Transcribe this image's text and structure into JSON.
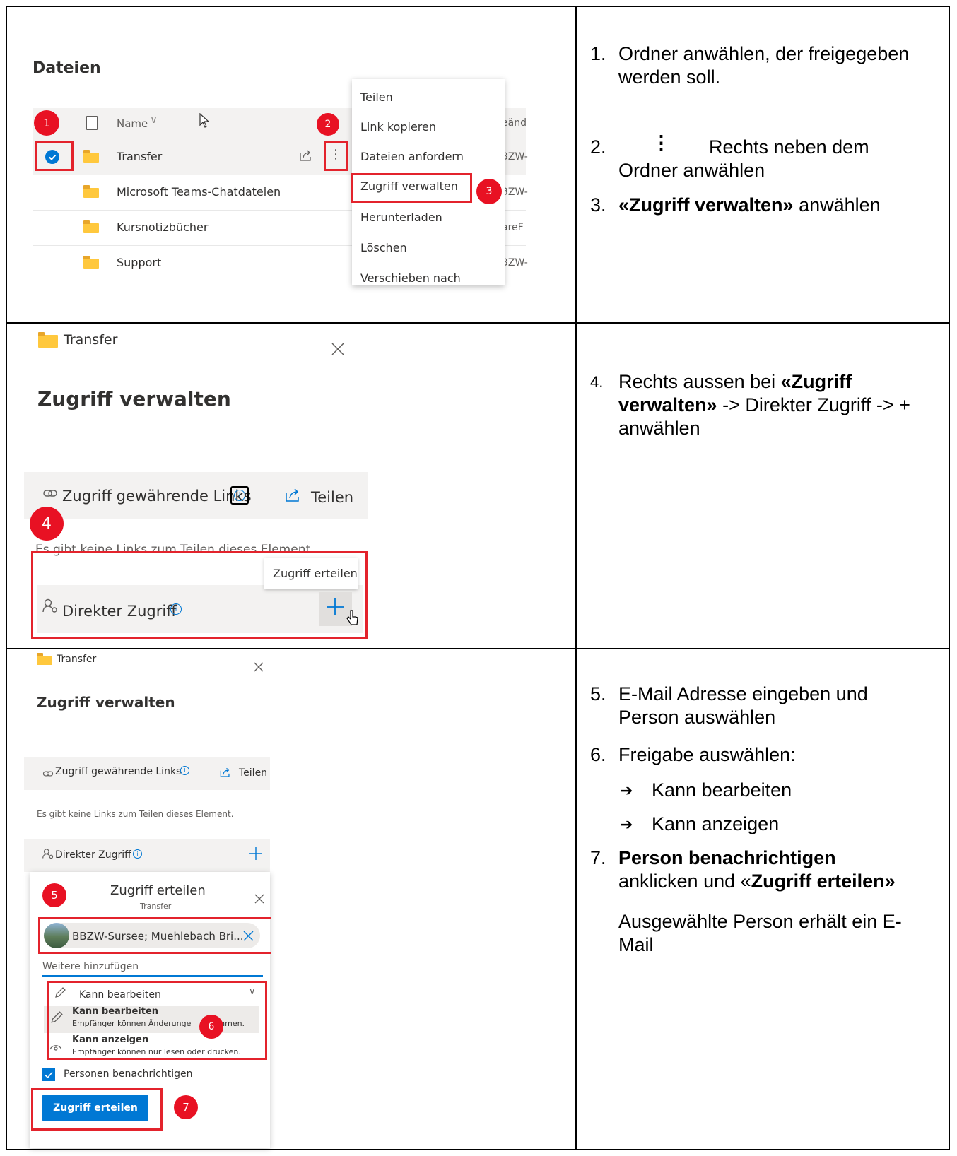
{
  "sec1": {
    "files_title": "Dateien",
    "name_header": "Name",
    "trunc_col_header": "eänd",
    "files": [
      {
        "name": "Transfer",
        "trunc": "3ZW-"
      },
      {
        "name": "Microsoft Teams-Chatdateien",
        "trunc": "3ZW-"
      },
      {
        "name": "Kursnotizbücher",
        "trunc": "areF"
      },
      {
        "name": "Support",
        "trunc": "3ZW-"
      }
    ],
    "menu": [
      "Teilen",
      "Link kopieren",
      "Dateien anfordern",
      "Zugriff verwalten",
      "Herunterladen",
      "Löschen",
      "Verschieben nach"
    ],
    "badges": [
      "1",
      "2",
      "3"
    ],
    "instructions": {
      "s1_num": "1.",
      "s1_text": "Ordner anwählen, der freigegeben werden soll.",
      "s2_num": "2.",
      "s2_icon": "⋮",
      "s2_text": "Rechts neben dem Ordner anwählen",
      "s3_num": "3.",
      "s3_bold": "«Zugriff verwalten»",
      "s3_rest": " anwählen"
    }
  },
  "sec2": {
    "breadcrumb": "Transfer",
    "title": "Zugriff verwalten",
    "links_label": "Zugriff gewährende Links",
    "share_label": "Teilen",
    "badge": "4",
    "no_links": "Es gibt keine Links zum Teilen dieses Element.",
    "tooltip": "Zugriff erteilen",
    "direct_label": "Direkter Zugriff",
    "instructions": {
      "num": "4.",
      "t1": "Rechts aussen bei ",
      "b1": "«Zugriff verwalten»",
      "t2": " -> Direkter Zugriff -> + anwählen"
    }
  },
  "sec3": {
    "breadcrumb": "Transfer",
    "title": "Zugriff verwalten",
    "links_label": "Zugriff gewährende Links",
    "share_label": "Teilen",
    "no_links": "Es gibt keine Links zum Teilen dieses Element.",
    "direct_label": "Direkter Zugriff",
    "dialog_title": "Zugriff erteilen",
    "dialog_subtitle": "Transfer",
    "person_chip": "BBZW-Sursee; Muehlebach Bri...",
    "add_more_placeholder": "Weitere hinzufügen",
    "permission_selected": "Kann bearbeiten",
    "options": [
      {
        "title": "Kann bearbeiten",
        "desc_a": "Empfänger können Änderunge",
        "desc_b": "ehmen."
      },
      {
        "title": "Kann anzeigen",
        "desc_a": "Empfänger können nur lesen oder drucken.",
        "desc_b": ""
      }
    ],
    "notify_label": "Personen benachrichtigen",
    "grant_button": "Zugriff erteilen",
    "badges": [
      "5",
      "6",
      "7"
    ],
    "instructions": {
      "s5_num": "5.",
      "s5_text": "E-Mail Adresse eingeben und Person auswählen",
      "s6_num": "6.",
      "s6_text": "Freigabe auswählen:",
      "arrow": "➔",
      "opt1": "Kann bearbeiten",
      "opt2": "Kann anzeigen",
      "s7_num": "7.",
      "s7_bold": "Person benachrichtigen",
      "s7_mid": " anklicken und «",
      "s7_bold2": "Zugriff erteilen»",
      "s7_note": "Ausgewählte Person erhält ein E-Mail"
    }
  },
  "colors": {
    "accent": "#0078d4",
    "badge": "#e81123",
    "highlight": "#e3232c"
  }
}
